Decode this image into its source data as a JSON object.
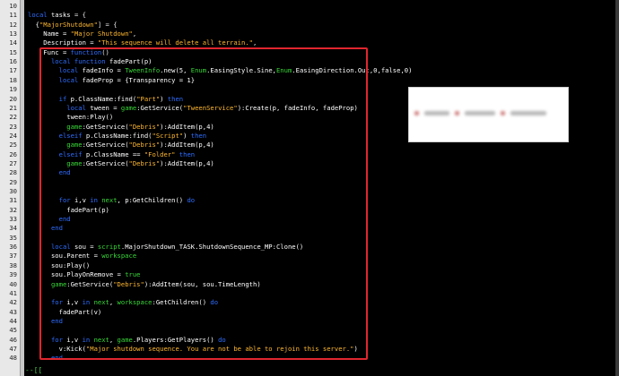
{
  "editor": {
    "line_numbers": [
      "10",
      "11",
      "12",
      "13",
      "14",
      "15",
      "16",
      "17",
      "18",
      "19",
      "20",
      "21",
      "22",
      "23",
      "24",
      "25",
      "26",
      "27",
      "28",
      "29",
      "30",
      "31",
      "32",
      "33",
      "34",
      "35",
      "36",
      "37",
      "38",
      "39",
      "40",
      "41",
      "42",
      "43",
      "44",
      "45",
      "46",
      "47",
      "48"
    ],
    "lines": [
      [],
      [
        [
          "kw",
          "local "
        ],
        [
          "id",
          "tasks "
        ],
        [
          "op",
          "= {"
        ]
      ],
      [
        [
          "id",
          "  {"
        ],
        [
          "str",
          "\"MajorShutdown\""
        ],
        [
          "op",
          "] = {"
        ]
      ],
      [
        [
          "id",
          "    Name = "
        ],
        [
          "str",
          "\"Major Shutdown\""
        ],
        [
          "op",
          ","
        ]
      ],
      [
        [
          "id",
          "    Description = "
        ],
        [
          "str",
          "\"This sequence will delete all terrain.\""
        ],
        [
          "op",
          ","
        ]
      ],
      [
        [
          "id",
          "    Func = "
        ],
        [
          "kw",
          "function"
        ],
        [
          "op",
          "()"
        ]
      ],
      [
        [
          "id",
          "      "
        ],
        [
          "kw",
          "local function "
        ],
        [
          "id",
          "fadePart(p)"
        ]
      ],
      [
        [
          "id",
          "        "
        ],
        [
          "kw",
          "local "
        ],
        [
          "id",
          "fadeInfo = "
        ],
        [
          "gr",
          "TweenInfo"
        ],
        [
          "id",
          ".new(5, "
        ],
        [
          "gr",
          "Enum"
        ],
        [
          "id",
          ".EasingStyle.Sine,"
        ],
        [
          "gr",
          "Enum"
        ],
        [
          "id",
          ".EasingDirection.Out,0,false,0)"
        ]
      ],
      [
        [
          "id",
          "        "
        ],
        [
          "kw",
          "local "
        ],
        [
          "id",
          "fadeProp = {Transparency = 1}"
        ]
      ],
      [],
      [
        [
          "id",
          "        "
        ],
        [
          "kw",
          "if "
        ],
        [
          "id",
          "p.ClassName:find("
        ],
        [
          "str",
          "\"Part\""
        ],
        [
          "id",
          ") "
        ],
        [
          "kw",
          "then"
        ]
      ],
      [
        [
          "id",
          "          "
        ],
        [
          "kw",
          "local "
        ],
        [
          "id",
          "tween = "
        ],
        [
          "gr",
          "game"
        ],
        [
          "id",
          ":GetService("
        ],
        [
          "str",
          "\"TweenService\""
        ],
        [
          "id",
          "):Create(p, fadeInfo, fadeProp)"
        ]
      ],
      [
        [
          "id",
          "          tween:Play()"
        ]
      ],
      [
        [
          "id",
          "          "
        ],
        [
          "gr",
          "game"
        ],
        [
          "id",
          ":GetService("
        ],
        [
          "str",
          "\"Debris\""
        ],
        [
          "id",
          "):AddItem(p,4)"
        ]
      ],
      [
        [
          "id",
          "        "
        ],
        [
          "kw",
          "elseif "
        ],
        [
          "id",
          "p.ClassName:find("
        ],
        [
          "str",
          "\"Script\""
        ],
        [
          "id",
          ") "
        ],
        [
          "kw",
          "then"
        ]
      ],
      [
        [
          "id",
          "          "
        ],
        [
          "gr",
          "game"
        ],
        [
          "id",
          ":GetService("
        ],
        [
          "str",
          "\"Debris\""
        ],
        [
          "id",
          "):AddItem(p,4)"
        ]
      ],
      [
        [
          "id",
          "        "
        ],
        [
          "kw",
          "elseif "
        ],
        [
          "id",
          "p.ClassName == "
        ],
        [
          "str",
          "\"Folder\""
        ],
        [
          "id",
          " "
        ],
        [
          "kw",
          "then"
        ]
      ],
      [
        [
          "id",
          "          "
        ],
        [
          "gr",
          "game"
        ],
        [
          "id",
          ":GetService("
        ],
        [
          "str",
          "\"Debris\""
        ],
        [
          "id",
          "):AddItem(p,4)"
        ]
      ],
      [
        [
          "id",
          "        "
        ],
        [
          "kw",
          "end"
        ]
      ],
      [],
      [],
      [
        [
          "id",
          "        "
        ],
        [
          "kw",
          "for "
        ],
        [
          "id",
          "i,v "
        ],
        [
          "kw",
          "in "
        ],
        [
          "gr",
          "next"
        ],
        [
          "id",
          ", p:GetChildren() "
        ],
        [
          "kw",
          "do"
        ]
      ],
      [
        [
          "id",
          "          fadePart(p)"
        ]
      ],
      [
        [
          "id",
          "        "
        ],
        [
          "kw",
          "end"
        ]
      ],
      [
        [
          "id",
          "      "
        ],
        [
          "kw",
          "end"
        ]
      ],
      [],
      [
        [
          "id",
          "      "
        ],
        [
          "kw",
          "local "
        ],
        [
          "id",
          "sou = "
        ],
        [
          "gr",
          "script"
        ],
        [
          "id",
          ".MajorShutdown_TASK.ShutdownSequence_MP:Clone()"
        ]
      ],
      [
        [
          "id",
          "      sou.Parent = "
        ],
        [
          "gr",
          "workspace"
        ]
      ],
      [
        [
          "id",
          "      sou:Play()"
        ]
      ],
      [
        [
          "id",
          "      sou.PlayOnRemove = "
        ],
        [
          "gr",
          "true"
        ]
      ],
      [
        [
          "id",
          "      "
        ],
        [
          "gr",
          "game"
        ],
        [
          "id",
          ":GetService("
        ],
        [
          "str",
          "\"Debris\""
        ],
        [
          "id",
          "):AddItem(sou, sou.TimeLength)"
        ]
      ],
      [],
      [
        [
          "id",
          "      "
        ],
        [
          "kw",
          "for "
        ],
        [
          "id",
          "i,v "
        ],
        [
          "kw",
          "in "
        ],
        [
          "gr",
          "next"
        ],
        [
          "id",
          ", "
        ],
        [
          "gr",
          "workspace"
        ],
        [
          "id",
          ":GetChildren() "
        ],
        [
          "kw",
          "do"
        ]
      ],
      [
        [
          "id",
          "        fadePart(v)"
        ]
      ],
      [
        [
          "id",
          "      "
        ],
        [
          "kw",
          "end"
        ]
      ],
      [],
      [
        [
          "id",
          "      "
        ],
        [
          "kw",
          "for "
        ],
        [
          "id",
          "i,v "
        ],
        [
          "kw",
          "in "
        ],
        [
          "gr",
          "next"
        ],
        [
          "id",
          ", "
        ],
        [
          "gr",
          "game"
        ],
        [
          "id",
          ".Players:GetPlayers() "
        ],
        [
          "kw",
          "do"
        ]
      ],
      [
        [
          "id",
          "        v:Kick("
        ],
        [
          "str",
          "\"Major shutdown sequence. You are not be able to rejoin this server.\""
        ],
        [
          "id",
          ")"
        ]
      ],
      [
        [
          "id",
          "      "
        ],
        [
          "kw",
          "end"
        ]
      ]
    ],
    "bottom_marker": "--[[",
    "colors": {
      "background": "#000000",
      "keyword": "#2f6dff",
      "builtin": "#39d839",
      "string": "#ffb830",
      "identifier": "#ffffff",
      "operator": "#e8e8e8",
      "highlight_border": "#e0262e"
    }
  },
  "overlay_panel": {
    "blurred": true
  }
}
